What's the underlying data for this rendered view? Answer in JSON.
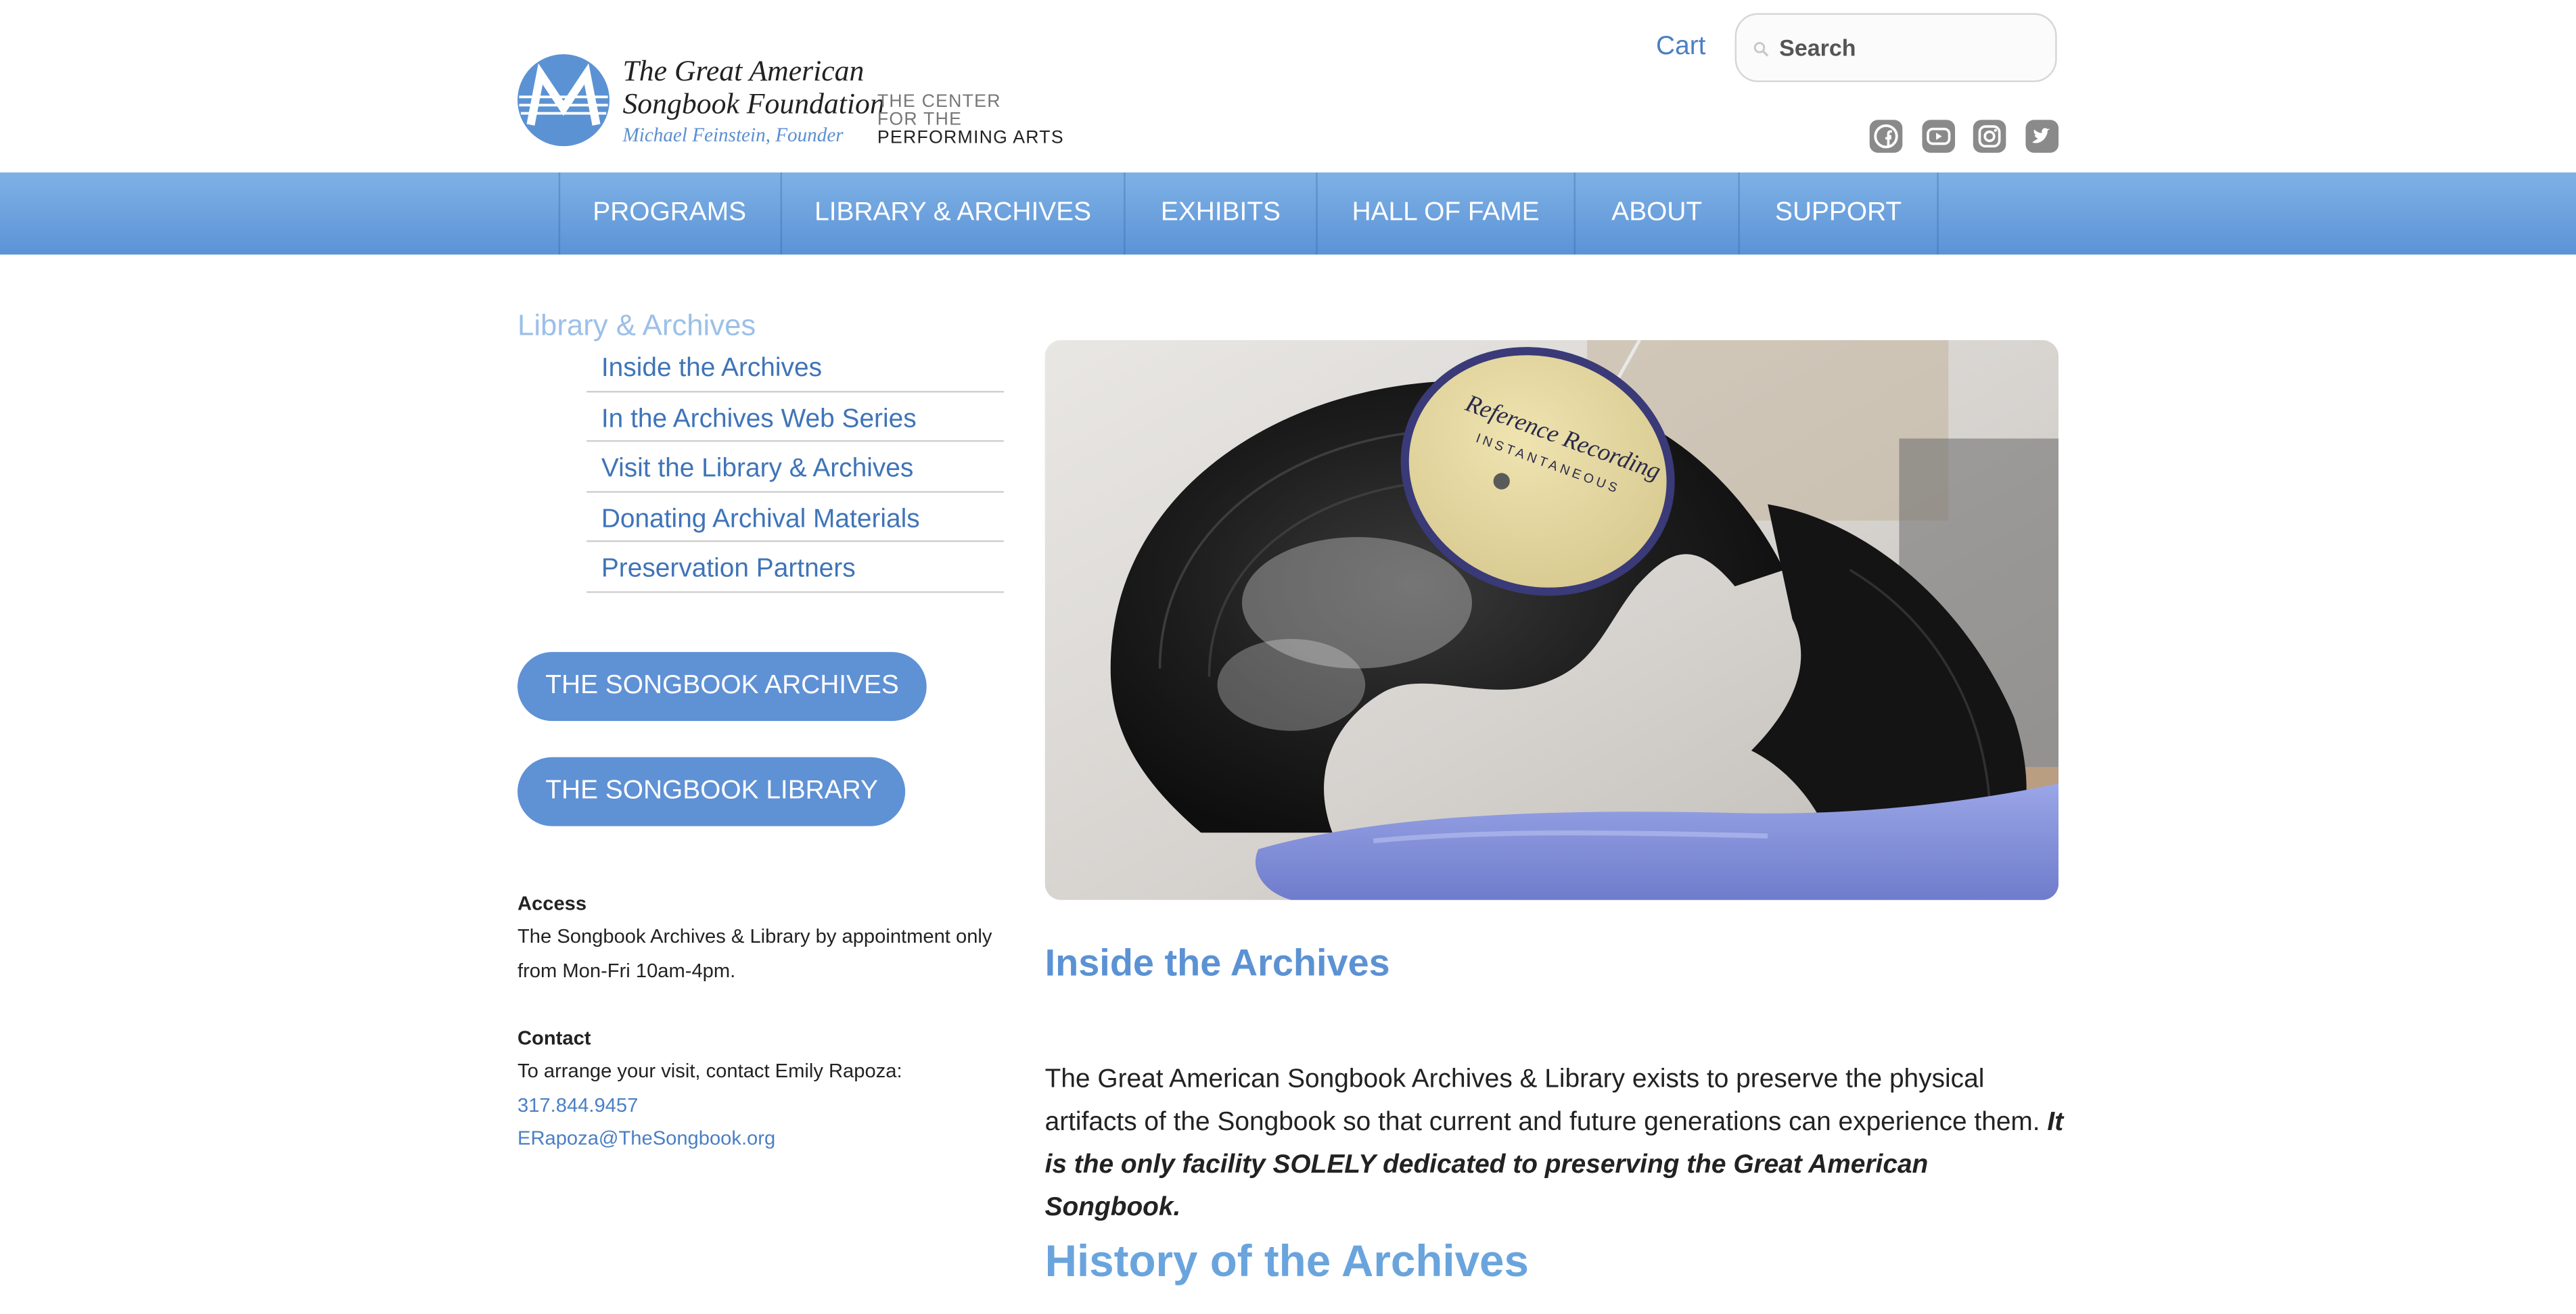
{
  "header": {
    "logo": {
      "title": "The Great American\nSongbook Foundation",
      "founder": "Michael Feinstein, Founder",
      "center_line1": "THE CENTER",
      "center_line2": "FOR THE",
      "center_line3": "PERFORMING ARTS"
    },
    "cart_label": "Cart",
    "search_placeholder": "Search",
    "social_icons": [
      "facebook-icon",
      "youtube-icon",
      "instagram-icon",
      "twitter-icon"
    ]
  },
  "nav": {
    "items": [
      {
        "label": "PROGRAMS"
      },
      {
        "label": "LIBRARY & ARCHIVES"
      },
      {
        "label": "EXHIBITS"
      },
      {
        "label": "HALL OF FAME"
      },
      {
        "label": "ABOUT"
      },
      {
        "label": "SUPPORT"
      }
    ]
  },
  "sidebar": {
    "heading": "Library & Archives",
    "items": [
      {
        "label": "Inside the Archives"
      },
      {
        "label": "In the Archives Web Series"
      },
      {
        "label": "Visit the Library & Archives"
      },
      {
        "label": "Donating Archival Materials"
      },
      {
        "label": "Preservation Partners"
      }
    ],
    "buttons": {
      "archives": "THE SONGBOOK ARCHIVES",
      "library": "THE SONGBOOK LIBRARY"
    },
    "access": {
      "label": "Access",
      "text": "The Songbook Archives & Library by appointment only from Mon-Fri 10am-4pm."
    },
    "contact": {
      "label": "Contact",
      "text": "To arrange your visit, contact Emily Rapoza:",
      "phone": "317.844.9457",
      "email": "ERapoza@TheSongbook.org"
    }
  },
  "main": {
    "hero_image": {
      "record_label_line1": "Reference Recording",
      "record_label_line2": "INSTANTANEOUS"
    },
    "title": "Inside the Archives",
    "intro_text": "The Great American Songbook Archives & Library exists to preserve the physical artifacts of the Songbook so that current and future generations can experience them.",
    "intro_emphasis": "It is the only facility SOLELY dedicated to preserving the Great American Songbook.",
    "section_title": "History of the Archives"
  },
  "colors": {
    "brand_blue": "#5b92d3",
    "nav_gradient_top": "#7fb1e6",
    "nav_gradient_bottom": "#5b93d6",
    "link_blue": "#3f74b8",
    "button_blue": "#5f91d5",
    "sidebar_heading": "#9cc0e8"
  }
}
